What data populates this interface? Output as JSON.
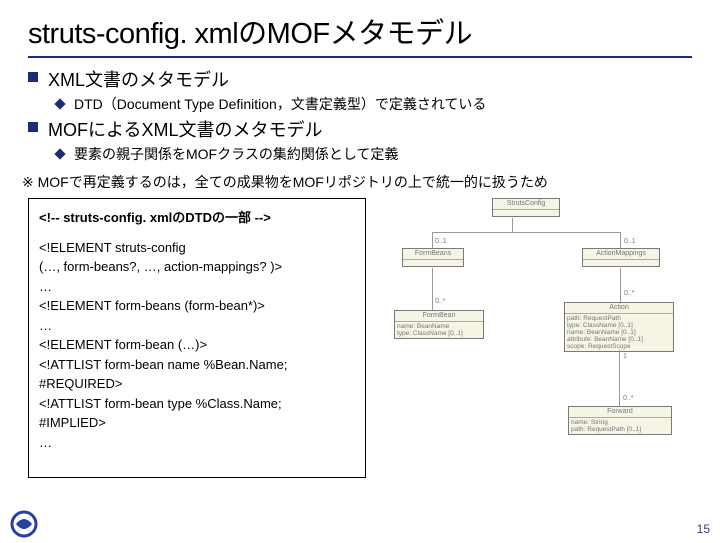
{
  "title": "struts-config. xmlのMOFメタモデル",
  "bullets": [
    {
      "level": 1,
      "text": "XML文書のメタモデル"
    },
    {
      "level": 2,
      "text": "DTD（Document Type Definition，文書定義型）で定義されている"
    },
    {
      "level": 1,
      "text": "MOFによるXML文書のメタモデル"
    },
    {
      "level": 2,
      "text": "要素の親子関係をMOFクラスの集約関係として定義"
    }
  ],
  "note": "※ MOFで再定義するのは，全ての成果物をMOFリポジトリの上で統一的に扱うため",
  "code": {
    "c0": "<!-- struts-config. xmlのDTDの一部 -->",
    "c1": "<!ELEMENT struts-config",
    "c2": "   (…, form-beans?, …, action-mappings? )>",
    "c3": "…",
    "c4": "<!ELEMENT form-beans (form-bean*)>",
    "c5": "…",
    "c6": "<!ELEMENT form-bean (…)>",
    "c7": "<!ATTLIST form-bean  name  %Bean.Name;",
    "c8": "                                           #REQUIRED>",
    "c9": "<!ATTLIST form-bean  type   %Class.Name;",
    "c10": "                                           #IMPLIED>",
    "c11": "…"
  },
  "uml": {
    "StrutsConfig": "StrutsConfig",
    "FormBeans": "FormBeans",
    "ActionMappings": "ActionMappings",
    "FormBean": "FormBean",
    "Action": "Action",
    "Forward": "Forward",
    "fb_body": "name: BeanName\ntype: ClassName [0..1]",
    "ac_body": "path: RequestPath\ntype: ClassName [0..1]\nname: BeanName [0..1]\nattribute: BeanName [0..1]\nscope: RequestScope",
    "fw_body": "name: String\npath: RequestPath [0..1]",
    "m01": "0..1",
    "m0n": "0..*",
    "m1": "1"
  },
  "pagenum": "15"
}
